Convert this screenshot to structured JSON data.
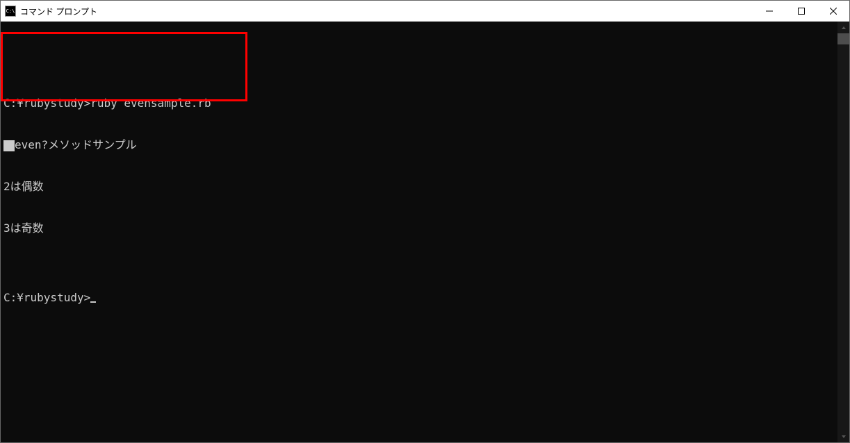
{
  "window": {
    "title": "コマンド プロンプト",
    "icon_label": "C:\\"
  },
  "terminal": {
    "lines": [
      "C:¥rubystudy>ruby evensample.rb",
      "even?メソッドサンプル",
      "2は偶数",
      "3は奇数",
      "",
      "C:¥rubystudy>"
    ]
  }
}
